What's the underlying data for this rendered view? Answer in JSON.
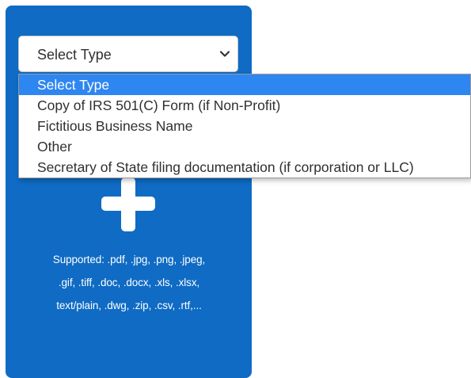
{
  "select": {
    "value": "Select Type",
    "options": [
      "Select Type",
      "Copy of IRS 501(C) Form (if Non-Profit)",
      "Fictitious Business Name",
      "Other",
      "Secretary of State filing documentation (if corporation or LLC)"
    ],
    "selected_index": 0
  },
  "upload": {
    "icon": "plus-icon",
    "supported_lines": [
      "Supported: .pdf, .jpg, .png, .jpeg,",
      ".gif, .tiff, .doc, .docx, .xls, .xlsx,",
      "text/plain, .dwg, .zip, .csv, .rtf,..."
    ]
  },
  "colors": {
    "panel": "#0f6bc4",
    "option_highlight": "#2e86f0"
  }
}
